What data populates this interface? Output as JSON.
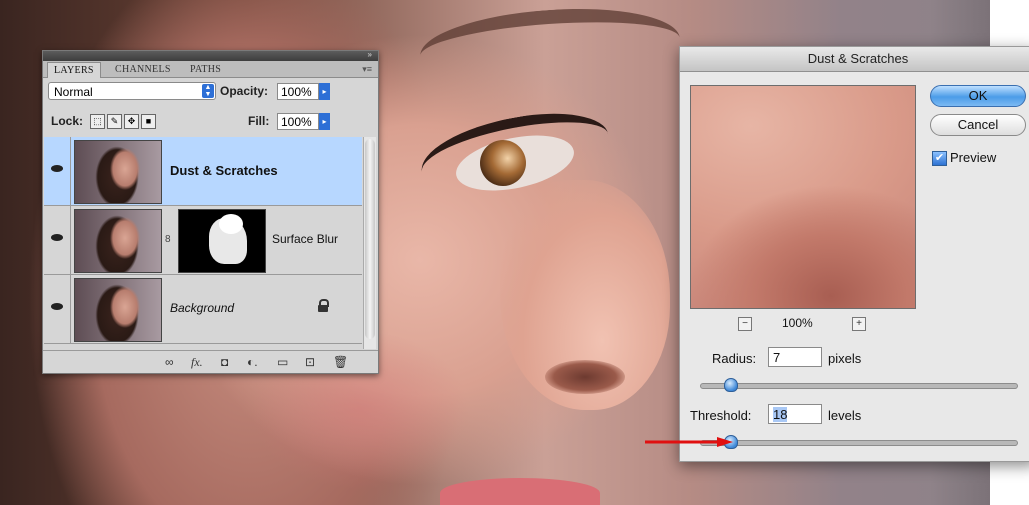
{
  "layers_panel": {
    "tabs": [
      "LAYERS",
      "CHANNELS",
      "PATHS"
    ],
    "blend_mode": "Normal",
    "opacity_label": "Opacity:",
    "opacity_value": "100%",
    "lock_label": "Lock:",
    "fill_label": "Fill:",
    "fill_value": "100%",
    "layers": [
      {
        "name": "Dust & Scratches",
        "selected": true
      },
      {
        "name": "Surface Blur",
        "selected": false
      },
      {
        "name": "Background",
        "selected": false,
        "locked": true
      }
    ],
    "footer_icons": [
      "link-icon",
      "fx-icon",
      "mask-icon",
      "adjustment-icon",
      "group-icon",
      "new-layer-icon",
      "trash-icon"
    ]
  },
  "dialog": {
    "title": "Dust & Scratches",
    "ok_label": "OK",
    "cancel_label": "Cancel",
    "preview_label": "Preview",
    "preview_checked": true,
    "zoom": "100%",
    "radius_label": "Radius:",
    "radius_value": "7",
    "radius_unit": "pixels",
    "threshold_label": "Threshold:",
    "threshold_value": "18",
    "threshold_unit": "levels"
  },
  "colors": {
    "selected_layer": "#b7d7ff",
    "ok_button": "#4b9ce8",
    "arrow": "#e01010"
  }
}
